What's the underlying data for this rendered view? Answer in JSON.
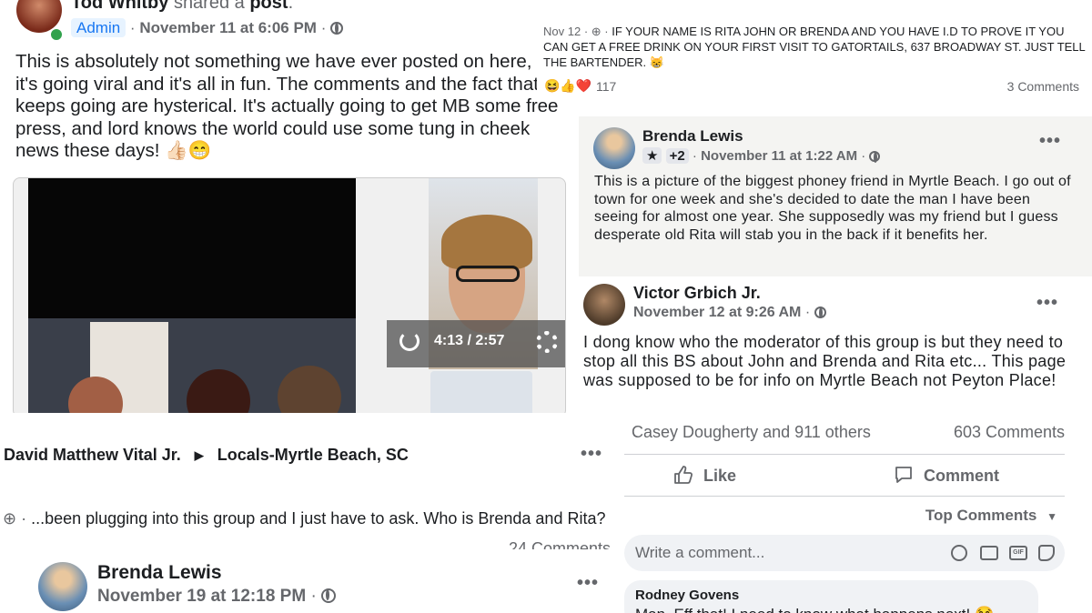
{
  "post_tod": {
    "author": "Tod Whitby",
    "action": "shared a",
    "object": "post",
    "badge": "Admin",
    "timestamp": "November 11 at 6:06 PM",
    "text": "This is absolutely not something we have ever posted on here, but it's going viral and it's all in fun. The comments and the fact that keeps going are hysterical. It's actually going to get MB some free press, and lord knows the world could use some tung in cheek news these days! 👍🏻😁",
    "video_time": "4:13 / 2:57"
  },
  "post_rita_ad": {
    "date": "Nov 12",
    "text": "IF YOUR NAME IS RITA JOHN OR BRENDA AND YOU HAVE I.D TO PROVE IT YOU CAN GET A FREE DRINK ON YOUR FIRST VISIT TO GATORTAILS, 637 BROADWAY ST. JUST TELL THE BARTENDER. 😸",
    "reactions_emoji": "😆👍❤️",
    "reaction_count": "117",
    "comments": "3 Comments"
  },
  "post_brenda_1": {
    "author": "Brenda Lewis",
    "badge_count": "+2",
    "timestamp": "November 11 at 1:22 AM",
    "text": "This is a picture of the biggest phoney friend in Myrtle Beach. I go out of town for one week and she's decided to date the man I have been seeing for almost one year. She supposedly was my friend but I guess desperate old Rita will stab you in the back if it benefits her."
  },
  "post_victor": {
    "author": "Victor Grbich Jr.",
    "timestamp": "November 12 at 9:26 AM",
    "text": "I dong know who the moderator of this group is but they need to stop all this BS about John and Brenda and Rita etc... This page was supposed to be for info on Myrtle Beach not Peyton Place!",
    "reactions": "Casey Dougherty and 911 others",
    "comments": "603 Comments",
    "like_label": "Like",
    "comment_label": "Comment",
    "sort_label": "Top Comments",
    "write_placeholder": "Write a comment...",
    "reply_author": "Rodney Govens",
    "reply_text": "Man, Eff that! I need to know what happens next! 😂"
  },
  "post_david": {
    "author": "David Matthew Vital Jr.",
    "group": "Locals-Myrtle Beach, SC",
    "text": "...been plugging into this group and I just have to ask. Who is Brenda and Rita?",
    "comments": "24 Comments"
  },
  "post_brenda_2": {
    "author": "Brenda Lewis",
    "timestamp": "November 19 at 12:18 PM"
  },
  "colors": {
    "accent": "#1877f2",
    "muted": "#65676b",
    "divider": "#ced0d4"
  }
}
